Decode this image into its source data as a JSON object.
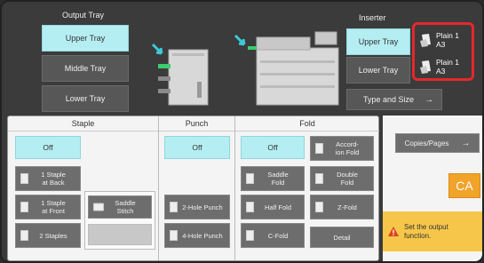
{
  "header": {
    "output_tray_title": "Output Tray",
    "inserter_title": "Inserter"
  },
  "output_tray": {
    "upper": "Upper Tray",
    "middle": "Middle Tray",
    "lower": "Lower Tray",
    "selected": "Upper Tray"
  },
  "inserter": {
    "upper": "Upper Tray",
    "lower": "Lower Tray",
    "type_and_size": "Type and Size",
    "selected": "Upper Tray"
  },
  "paper_status": [
    {
      "type": "Plain 1",
      "size": "A3"
    },
    {
      "type": "Plain 1",
      "size": "A3"
    }
  ],
  "staple": {
    "title": "Staple",
    "off": "Off",
    "one_back": "1 Staple\nat Back",
    "one_front": "1 Staple\nat Front",
    "two": "2 Staples",
    "saddle": "Saddle\nStitch",
    "selected": "Off"
  },
  "punch": {
    "title": "Punch",
    "off": "Off",
    "two_hole": "2-Hole Punch",
    "four_hole": "4-Hole Punch",
    "selected": "Off"
  },
  "fold": {
    "title": "Fold",
    "off": "Off",
    "accordion": "Accord-\nion Fold",
    "saddle": "Saddle\nFold",
    "double": "Double\nFold",
    "half": "Half Fold",
    "z": "Z-Fold",
    "c": "C-Fold",
    "detail": "Detail",
    "selected": "Off"
  },
  "side": {
    "copies_pages": "Copies/Pages",
    "ca": "CA",
    "warning": "Set the output\nfunction."
  },
  "colors": {
    "selected": "#b5eef2",
    "highlight_border": "#e4282d",
    "warning_bg": "#f6c64a",
    "ca_bg": "#f1a32a"
  }
}
